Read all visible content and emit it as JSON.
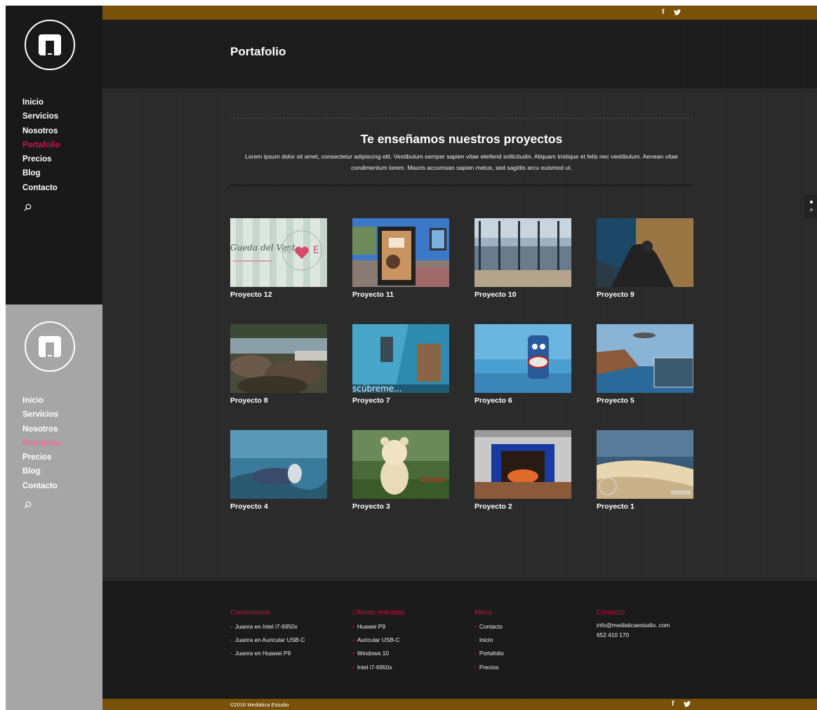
{
  "nav": {
    "items": [
      "Inicio",
      "Servicios",
      "Nosotros",
      "Portafolio",
      "Precios",
      "Blog",
      "Contacto"
    ],
    "active": "Portafolio"
  },
  "social": {
    "facebook": "f",
    "twitter_icon": "twitter-icon"
  },
  "header": {
    "title": "Portafolio"
  },
  "intro": {
    "title": "Te enseñamos nuestros proyectos",
    "description": "Lorem ipsum dolor sit amet, consectetur adipiscing elit. Vestibulum semper sapien vitae eleifend sollicitudin. Aliquam tristique et felis nec vestibulum. Aenean vitae condimentum lorem. Mauris accumsan sapien metus, sed sagittis arcu euismod ut."
  },
  "projects": [
    {
      "title": "Proyecto 12",
      "thumb_text": "Gueda del Vent"
    },
    {
      "title": "Proyecto 11"
    },
    {
      "title": "Proyecto 10"
    },
    {
      "title": "Proyecto 9"
    },
    {
      "title": "Proyecto 8"
    },
    {
      "title": "Proyecto 7",
      "thumb_text": "scúbreme..."
    },
    {
      "title": "Proyecto 6"
    },
    {
      "title": "Proyecto 5"
    },
    {
      "title": "Proyecto 4"
    },
    {
      "title": "Proyecto 3"
    },
    {
      "title": "Proyecto 2"
    },
    {
      "title": "Proyecto 1"
    }
  ],
  "footer": {
    "comentarios": {
      "title": "Comentarios",
      "items": [
        "Juanra en Intel i7-6950x",
        "Juanra en Auricular USB-C",
        "Juanra en Huawei P9"
      ]
    },
    "ultimas": {
      "title": "Últimas entradas",
      "items": [
        "Huawei P9",
        "Auricular USB-C",
        "Windows 10",
        "Intel i7-6950x"
      ]
    },
    "menu": {
      "title": "Menú",
      "items": [
        "Contacto",
        "Inicio",
        "Portafolio",
        "Precios"
      ]
    },
    "contacto": {
      "title": "Contacto",
      "email": "info@mediaticaestudio. com",
      "phone": "652 410 170"
    },
    "copyright": "©2016 Mediática Estudio"
  },
  "colors": {
    "accent": "#d0154c",
    "topbar": "#7a5108"
  }
}
